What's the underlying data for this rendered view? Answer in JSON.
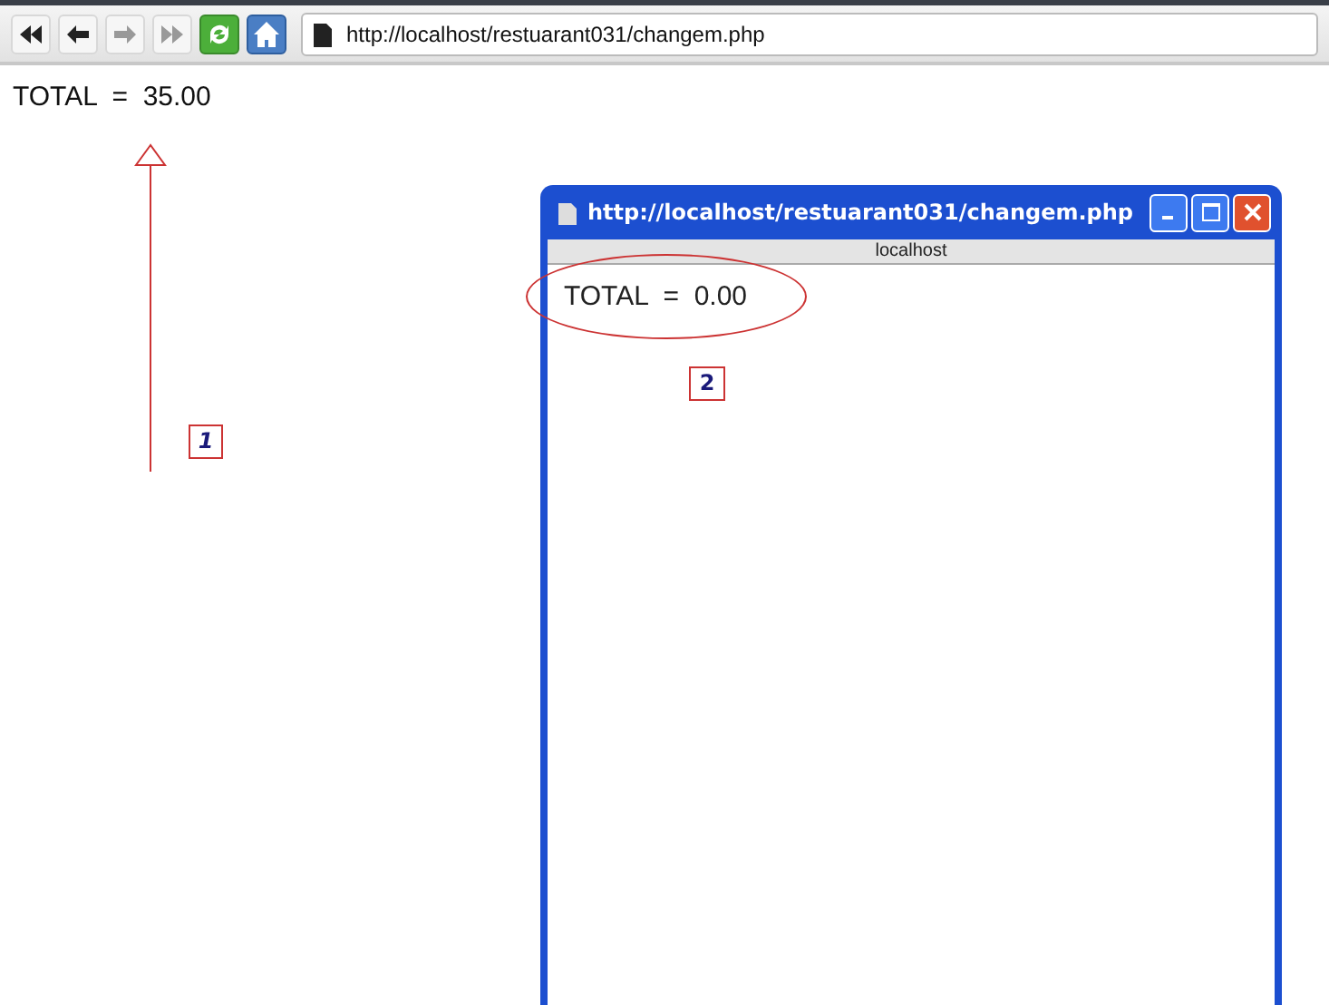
{
  "toolbar": {
    "url": "http://localhost/restuarant031/changem.php"
  },
  "page": {
    "text": "TOTAL  =  35.00"
  },
  "popup": {
    "title": "http://localhost/restuarant031/changem.php",
    "host": "localhost",
    "text": "TOTAL  =  0.00"
  },
  "annotations": [
    {
      "label": "1",
      "kind": "arrow"
    },
    {
      "label": "2",
      "kind": "ellipse"
    }
  ]
}
